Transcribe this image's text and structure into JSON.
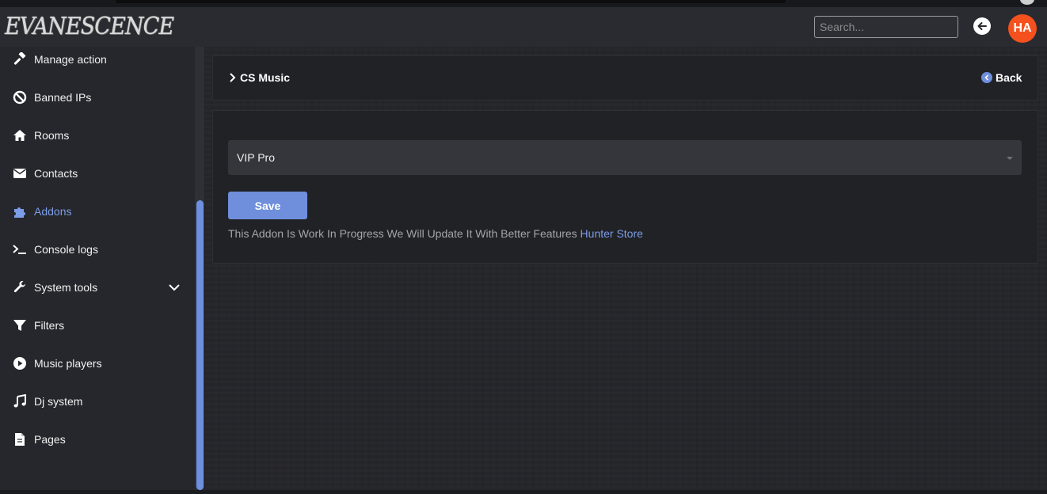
{
  "header": {
    "logo_text": "EVANESCENCE",
    "search_placeholder": "Search...",
    "avatar_initials": "HA",
    "avatar_color": "#f4511e"
  },
  "sidebar": {
    "items": [
      {
        "label": "Manage action",
        "icon": "gavel-icon"
      },
      {
        "label": "Banned IPs",
        "icon": "ban-icon"
      },
      {
        "label": "Rooms",
        "icon": "home-icon"
      },
      {
        "label": "Contacts",
        "icon": "envelope-icon"
      },
      {
        "label": "Addons",
        "icon": "puzzle-icon",
        "active": true
      },
      {
        "label": "Console logs",
        "icon": "terminal-icon"
      },
      {
        "label": "System tools",
        "icon": "wrench-icon",
        "expandable": true
      },
      {
        "label": "Filters",
        "icon": "filter-icon"
      },
      {
        "label": "Music players",
        "icon": "play-circle-icon"
      },
      {
        "label": "Dj system",
        "icon": "music-note-icon"
      },
      {
        "label": "Pages",
        "icon": "file-icon"
      }
    ]
  },
  "main": {
    "breadcrumb": "CS Music",
    "back_label": "Back",
    "select_value": "VIP Pro",
    "save_label": "Save",
    "note_text": "This Addon Is Work In Progress We Will Update It With Better Features ",
    "note_link": "Hunter Store"
  },
  "colors": {
    "accent": "#6f8fdd",
    "link": "#7c9de8",
    "panel": "#212226",
    "background": "#26272c"
  }
}
